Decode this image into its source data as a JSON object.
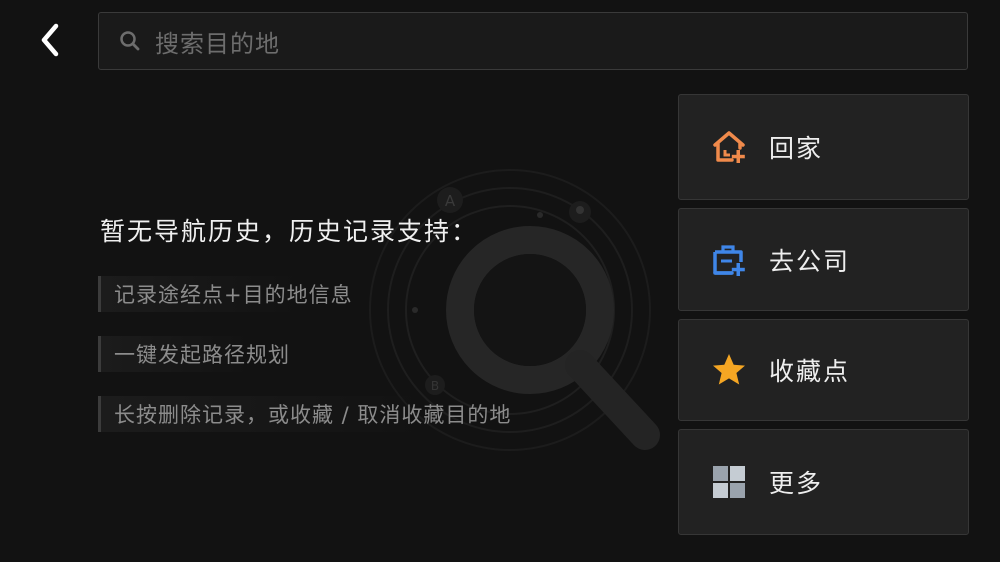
{
  "search": {
    "placeholder": "搜索目的地"
  },
  "empty": {
    "title": "暂无导航历史，历史记录支持：",
    "tips": [
      "记录途经点+目的地信息",
      "一键发起路径规划",
      "长按删除记录，或收藏 / 取消收藏目的地"
    ]
  },
  "shortcuts": [
    {
      "label": "回家",
      "icon": "home-add-icon",
      "color": "#f08a4b"
    },
    {
      "label": "去公司",
      "icon": "company-add-icon",
      "color": "#3f86e8"
    },
    {
      "label": "收藏点",
      "icon": "star-icon",
      "color": "#f5a623"
    },
    {
      "label": "更多",
      "icon": "grid-icon",
      "color": "#9aa3ad"
    }
  ],
  "background_labels": [
    "A",
    "B"
  ]
}
